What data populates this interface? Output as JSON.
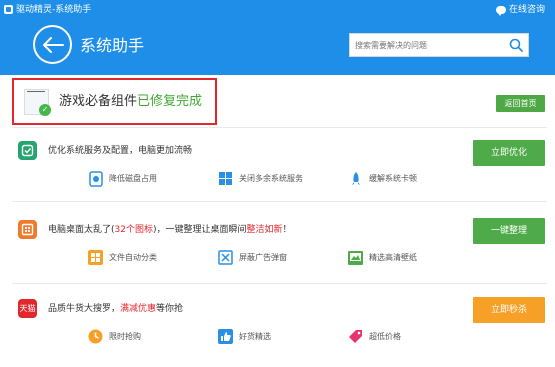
{
  "window": {
    "app_title": "驱动精灵-系统助手",
    "consult_label": "在线咨询"
  },
  "header": {
    "page_title": "系统助手",
    "search_placeholder": "搜索需要解决的问题"
  },
  "status": {
    "prefix": "游戏必备组件",
    "highlight": "已修复完成",
    "back_home_label": "返回首页"
  },
  "rows": [
    {
      "title": "优化系统服务及配置，电脑更加流畅",
      "button_label": "立即优化",
      "features": [
        "降低磁盘占用",
        "关闭多余系统服务",
        "缓解系统卡顿"
      ]
    },
    {
      "title_part1": "电脑桌面太乱了(",
      "title_count": "32个图标",
      "title_part2": ")，一键整理让桌面瞬间",
      "title_highlight": "整洁如新",
      "title_end": "！",
      "button_label": "一键整理",
      "features": [
        "文件自动分类",
        "屏蔽广告弹窗",
        "精选高清壁纸"
      ]
    },
    {
      "icon_text": "天猫",
      "title_part1": "品质牛货大搜罗，",
      "title_highlight": "满减优惠",
      "title_part2": "等你抢",
      "button_label": "立即秒杀",
      "features": [
        "限时抢购",
        "好货精选",
        "超低价格"
      ]
    }
  ],
  "colors": {
    "header_blue": "#1f8ee8",
    "accent_green": "#4fab49",
    "accent_orange": "#f7a028",
    "highlight_red": "#e0282e"
  }
}
